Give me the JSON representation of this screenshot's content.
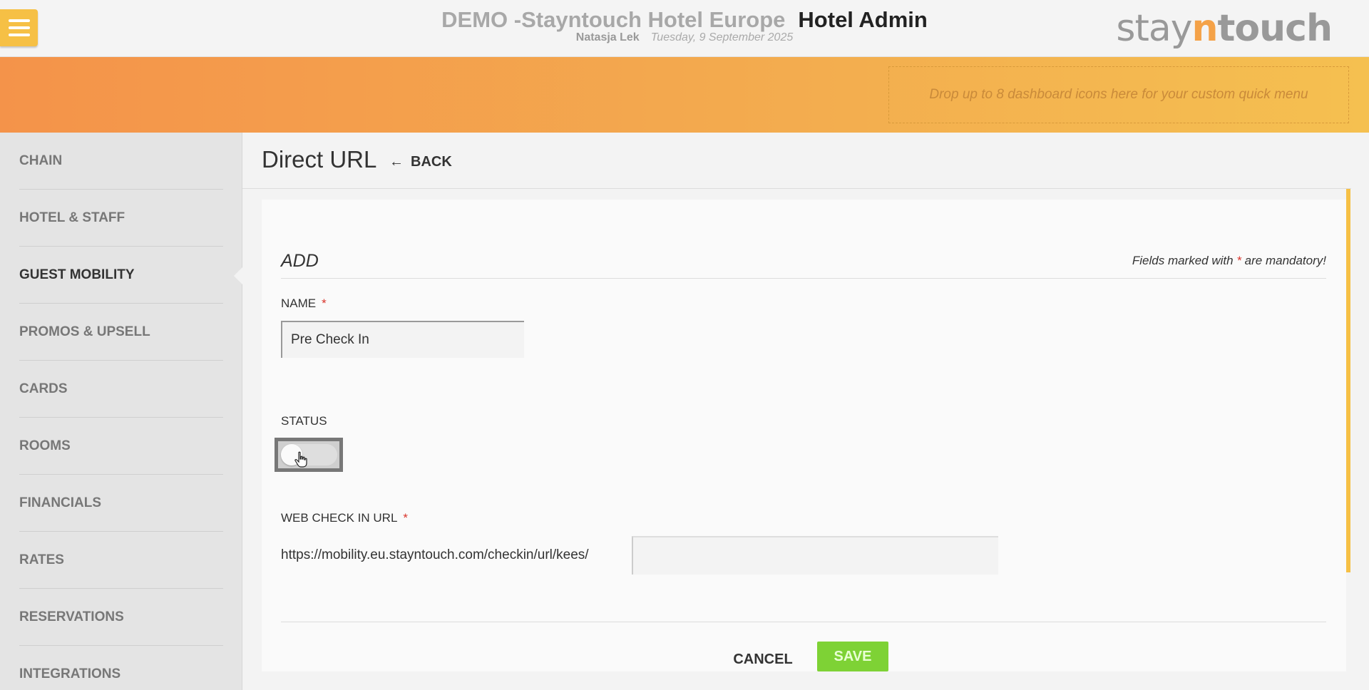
{
  "header": {
    "hotel_name": "DEMO -Stayntouch Hotel Europe",
    "app_name": "Hotel Admin",
    "user_name": "Natasja Lek",
    "date": "Tuesday, 9 September 2025",
    "logo": {
      "part1": "stay",
      "part2": "n",
      "part3": "touch"
    },
    "menu_icon": "hamburger-icon"
  },
  "banner": {
    "dropzone_text": "Drop up to 8 dashboard icons here for your custom quick menu"
  },
  "sidebar": {
    "items": [
      {
        "label": "CHAIN"
      },
      {
        "label": "HOTEL & STAFF"
      },
      {
        "label": "GUEST MOBILITY",
        "active": true
      },
      {
        "label": "PROMOS & UPSELL"
      },
      {
        "label": "CARDS"
      },
      {
        "label": "ROOMS"
      },
      {
        "label": "FINANCIALS"
      },
      {
        "label": "RATES"
      },
      {
        "label": "RESERVATIONS"
      },
      {
        "label": "INTEGRATIONS"
      }
    ]
  },
  "page": {
    "title": "Direct URL",
    "back_label": "BACK"
  },
  "form": {
    "heading": "ADD",
    "mandatory_prefix": "Fields marked with ",
    "mandatory_star": "*",
    "mandatory_suffix": " are mandatory!",
    "name_label": "NAME",
    "name_value": "Pre Check In",
    "status_label": "STATUS",
    "status_on": false,
    "url_label": "WEB CHECK IN URL",
    "url_prefix": "https://mobility.eu.stayntouch.com/checkin/url/kees/",
    "url_value": "",
    "required_mark": "*",
    "cancel_label": "CANCEL",
    "save_label": "SAVE"
  },
  "colors": {
    "accent": "#f6c045",
    "banner_start": "#f4934a",
    "banner_end": "#f5c050",
    "save": "#7ed235",
    "required": "#d9342b"
  }
}
